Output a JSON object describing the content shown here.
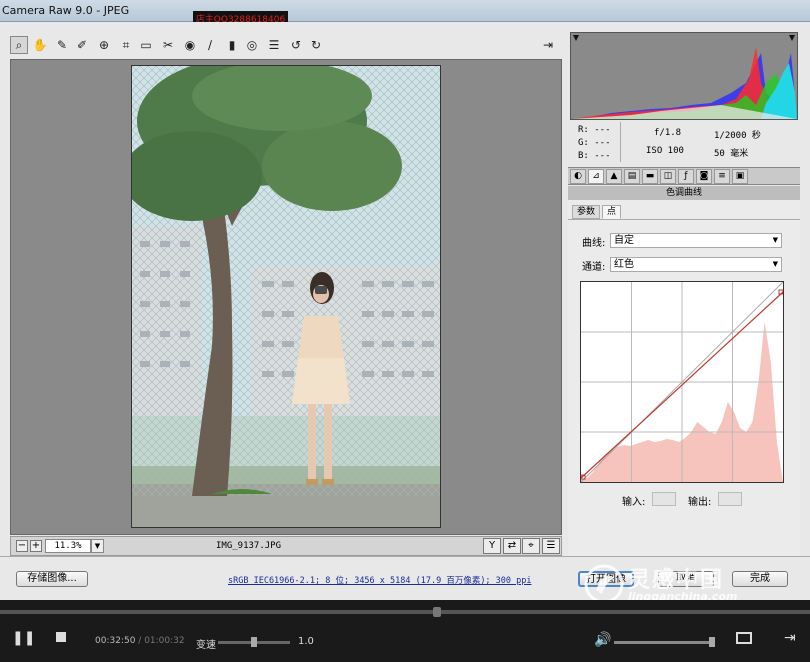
{
  "title": "Camera Raw 9.0 - JPEG",
  "watermark_top": "店主QQ3288618406",
  "toolbar": {
    "tools": [
      "zoom",
      "hand",
      "white-balance",
      "color-sampler",
      "targeted-adjust",
      "crop",
      "straighten",
      "spot-removal",
      "red-eye",
      "adjustment-brush",
      "graduated-filter",
      "radial-filter",
      "presets",
      "rotate-ccw",
      "rotate-cw"
    ],
    "open_prefs": "open-preferences"
  },
  "status": {
    "zoom_minus": "−",
    "zoom_plus": "+",
    "zoom": "11.3%",
    "filename": "IMG_9137.JPG"
  },
  "histogram": {
    "readout": {
      "r": "R:  ---",
      "g": "G:  ---",
      "b": "B:  ---"
    },
    "exif": {
      "aperture": "f/1.8",
      "shutter": "1/2000 秒",
      "iso": "ISO 100",
      "focal": "50 毫米"
    }
  },
  "panel": {
    "title": "色调曲线",
    "tabs": [
      "参数",
      "点"
    ],
    "active_tab": "点",
    "curve_label": "曲线:",
    "curve_value": "自定",
    "channel_label": "通道:",
    "channel_value": "红色",
    "input_label": "输入:",
    "output_label": "输出:",
    "curve_color": "#c0392b",
    "hist_fill": "#f7c3bd"
  },
  "bottom": {
    "save": "存储图像...",
    "workflow": "sRGB IEC61966-2.1; 8 位; 3456 x 5184 (17.9 百万像素); 300 ppi",
    "open": "打开图像",
    "cancel": "取消",
    "done": "完成"
  },
  "logo": {
    "cn": "灵感中国",
    "url": "lingganchina.com"
  },
  "player": {
    "progress": 0.54,
    "current": "00:32:50",
    "separator": " / ",
    "total": "01:00:32",
    "speed_label": "变速",
    "speed_value": "1.0",
    "speed_level": 0.5,
    "volume_level": 0.98
  }
}
